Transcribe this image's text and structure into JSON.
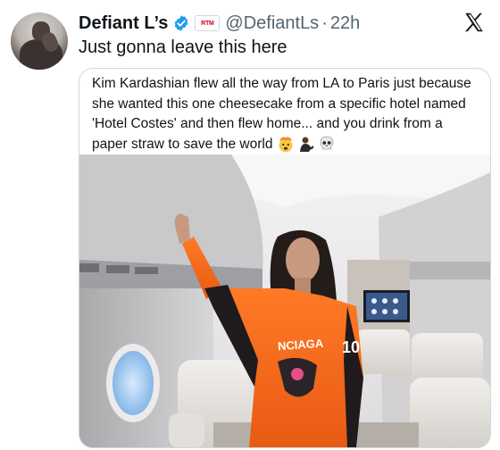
{
  "tweet": {
    "display_name": "Defiant L’s",
    "verified_icon": "verified-badge-icon",
    "affiliate_badge": "RTM",
    "handle": "@DefiantLs",
    "separator": "·",
    "time": "22h",
    "text": "Just gonna leave this here",
    "avatar_icon": "avatar-image",
    "platform_logo": "x-logo-icon"
  },
  "media": {
    "caption": "Kim Kardashian flew all the way from LA to Paris just because she wanted this one cheesecake from a specific hotel named 'Hotel Costes' and then flew home... and you drink from a paper straw to save the world",
    "caption_emojis": [
      "mind-blown-emoji",
      "person-emoji",
      "skull-emoji"
    ],
    "photo_description_icon": "private-jet-photo",
    "jersey_text": "NCIAGA",
    "jersey_number": "10",
    "colors": {
      "jersey": "#f26a1e",
      "cabin": "#dcdbdd",
      "verified": "#1d9bf0"
    }
  }
}
